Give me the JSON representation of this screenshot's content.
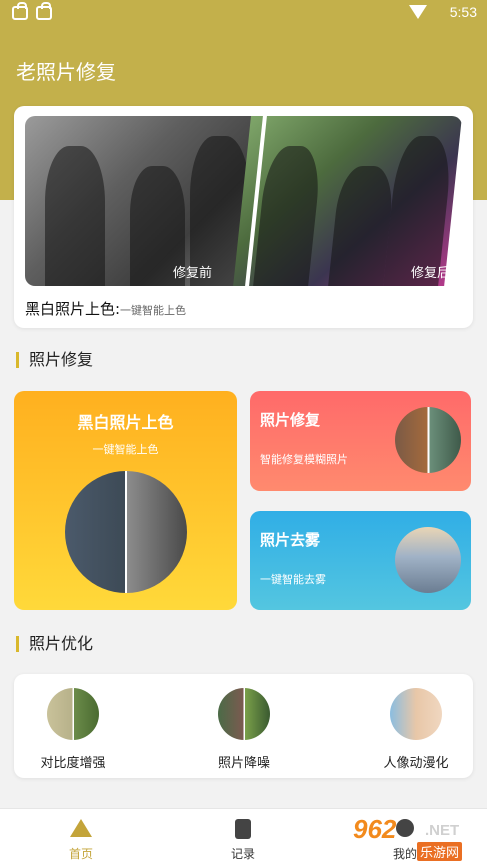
{
  "status_bar": {
    "time": "5:53",
    "icons": [
      "lock-icon",
      "lock-icon",
      "wifi-icon"
    ]
  },
  "app": {
    "title": "老照片修复"
  },
  "hero": {
    "before_label": "修复前",
    "after_label": "修复后",
    "caption_main": "黑白照片上色:",
    "caption_sub": "一键智能上色"
  },
  "section_repair": {
    "title": "照片修复"
  },
  "cards": {
    "colorize": {
      "title": "黑白照片上色",
      "subtitle": "一键智能上色"
    },
    "repair": {
      "title": "照片修复",
      "subtitle": "智能修复模糊照片"
    },
    "defog": {
      "title": "照片去雾",
      "subtitle": "一键智能去雾"
    }
  },
  "section_optimize": {
    "title": "照片优化"
  },
  "optimize_items": [
    {
      "label": "对比度增强"
    },
    {
      "label": "照片降噪"
    },
    {
      "label": "人像动漫化"
    }
  ],
  "bottom_nav": [
    {
      "label": "首页",
      "icon": "home-icon"
    },
    {
      "label": "记录",
      "icon": "clipboard-icon"
    },
    {
      "label": "我的",
      "icon": "user-icon"
    }
  ],
  "watermark": {
    "brand": "962",
    "suffix": ".NET",
    "cn": "乐游网"
  },
  "colors": {
    "header": "#c3b04b",
    "accent": "#c3a43a"
  }
}
